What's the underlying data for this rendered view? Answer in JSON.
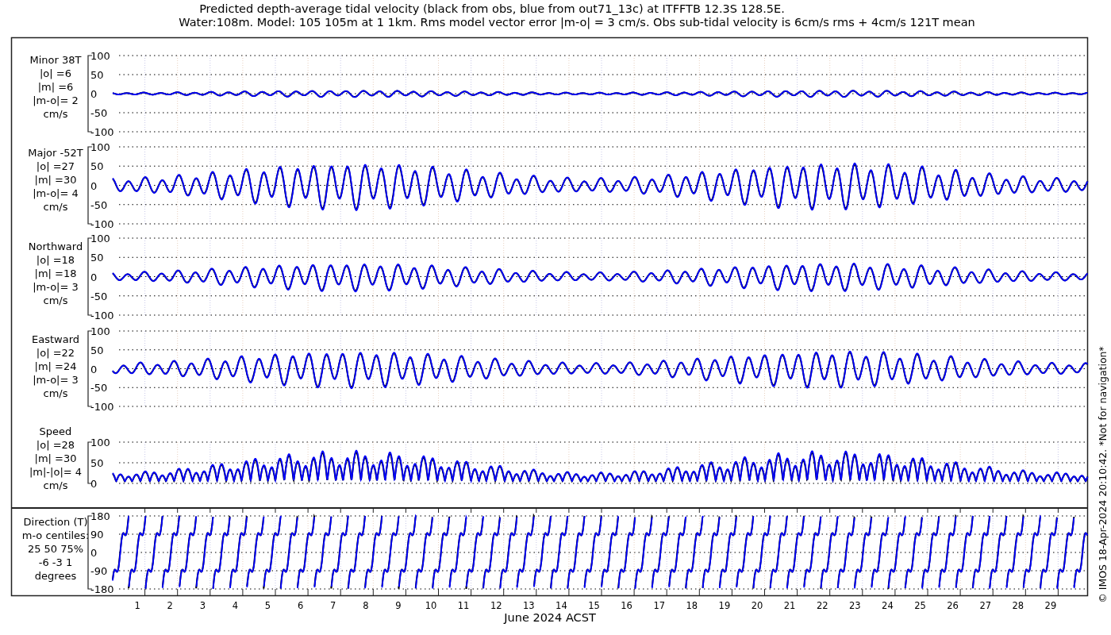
{
  "title_lines": [
    "Predicted depth-average tidal velocity (black from obs, blue from out71_13c) at ITFFTB 12.3S 128.5E.",
    "Water:108m. Model: 105 105m at 1 1km. Rms model vector error |m-o| = 3 cm/s. Obs sub-tidal velocity is 6cm/s rms + 4cm/s 121T mean"
  ],
  "panels": [
    {
      "kind": "signed",
      "label_lines": [
        "Minor 38T",
        "|o| =6",
        "|m| =6",
        "|m-o|= 2",
        "cm/s"
      ],
      "yticks": [
        "100",
        "50",
        "0",
        "-50",
        "-100"
      ]
    },
    {
      "kind": "signed",
      "label_lines": [
        "Major -52T",
        "|o| =27",
        "|m| =30",
        "|m-o|= 4",
        "cm/s"
      ],
      "yticks": [
        "100",
        "50",
        "0",
        "-50",
        "-100"
      ]
    },
    {
      "kind": "signed",
      "label_lines": [
        "Northward",
        "|o| =18",
        "|m| =18",
        "|m-o|= 3",
        "cm/s"
      ],
      "yticks": [
        "100",
        "50",
        "0",
        "-50",
        "-100"
      ]
    },
    {
      "kind": "signed",
      "label_lines": [
        "Eastward",
        "|o| =22",
        "|m| =24",
        "|m-o|= 3",
        "cm/s"
      ],
      "yticks": [
        "100",
        "50",
        "0",
        "-50",
        "-100"
      ]
    },
    {
      "kind": "speed",
      "label_lines": [
        "Speed",
        "|o| =28",
        "|m| =30",
        "|m|-|o|= 4",
        "cm/s"
      ],
      "yticks": [
        "100",
        "50",
        "0"
      ]
    },
    {
      "kind": "direction",
      "label_lines": [
        "Direction (T)",
        "m-o centiles:",
        "25  50  75%",
        "-6 -3  1",
        "degrees"
      ],
      "yticks": [
        "180",
        "90",
        "0",
        "-90",
        "-180"
      ]
    }
  ],
  "x_tick_labels": [
    "1",
    "2",
    "3",
    "4",
    "5",
    "6",
    "7",
    "8",
    "9",
    "10",
    "11",
    "12",
    "13",
    "14",
    "15",
    "16",
    "17",
    "18",
    "19",
    "20",
    "21",
    "22",
    "23",
    "24",
    "25",
    "26",
    "27",
    "28",
    "29"
  ],
  "xlabel": "June 2024 ACST",
  "copyright": "© IMOS 18-Apr-2024 20:10:42. *Not for navigation*"
}
